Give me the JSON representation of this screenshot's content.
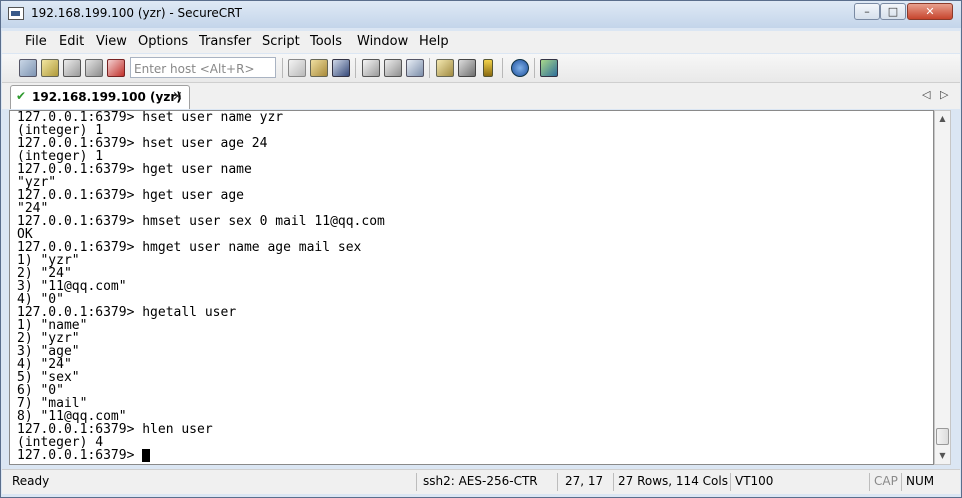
{
  "window": {
    "title": "192.168.199.100 (yzr) - SecureCRT",
    "controls": {
      "minimize": "–",
      "maximize": "□",
      "close": "✕"
    }
  },
  "menu": [
    "File",
    "Edit",
    "View",
    "Options",
    "Transfer",
    "Script",
    "Tools",
    "Window",
    "Help"
  ],
  "toolbar": {
    "quick_connect_placeholder": "Enter host <Alt+R>",
    "icons": [
      "connect-icon",
      "quick-connect-icon",
      "connect-in-tab-icon",
      "reconnect-icon",
      "disconnect-icon",
      "copy-icon",
      "paste-icon",
      "find-icon",
      "print-icon",
      "print-screen-icon",
      "log-session-icon",
      "session-options-icon",
      "global-options-icon",
      "keymap-icon",
      "help-icon",
      "sftp-icon"
    ]
  },
  "tab": {
    "label": "192.168.199.100 (yzr)",
    "close": "×",
    "nav_left": "◁",
    "nav_right": "▷"
  },
  "terminal": {
    "lines": [
      "127.0.0.1:6379> hset user name yzr",
      "(integer) 1",
      "127.0.0.1:6379> hset user age 24",
      "(integer) 1",
      "127.0.0.1:6379> hget user name",
      "\"yzr\"",
      "127.0.0.1:6379> hget user age",
      "\"24\"",
      "127.0.0.1:6379> hmset user sex 0 mail 11@qq.com",
      "OK",
      "127.0.0.1:6379> hmget user name age mail sex",
      "1) \"yzr\"",
      "2) \"24\"",
      "3) \"11@qq.com\"",
      "4) \"0\"",
      "127.0.0.1:6379> hgetall user",
      "1) \"name\"",
      "2) \"yzr\"",
      "3) \"age\"",
      "4) \"24\"",
      "5) \"sex\"",
      "6) \"0\"",
      "7) \"mail\"",
      "8) \"11@qq.com\"",
      "127.0.0.1:6379> hlen user",
      "(integer) 4"
    ],
    "prompt": "127.0.0.1:6379> "
  },
  "status": {
    "ready": "Ready",
    "encryption": "ssh2: AES-256-CTR",
    "position": "27,  17",
    "size": "27 Rows, 114 Cols",
    "terminal_type": "VT100",
    "caps": "CAP",
    "num": "NUM"
  }
}
